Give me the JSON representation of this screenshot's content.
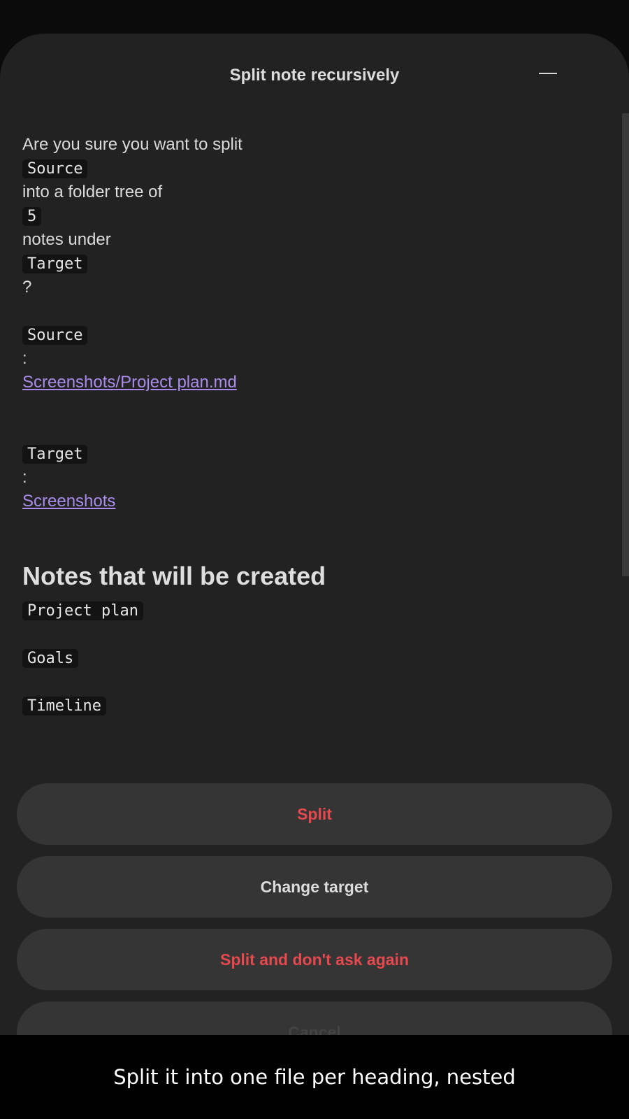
{
  "dialog": {
    "title": "Split note recursively",
    "collapse_icon": "minus-icon"
  },
  "message": {
    "intro": "Are you sure you want to split",
    "source_code": "Source",
    "into_text": "into a folder tree of",
    "count": "5",
    "notes_under_text": "notes under",
    "target_code": "Target",
    "question_mark": "?"
  },
  "source": {
    "label": "Source",
    "colon": ":",
    "link": "Screenshots/Project plan.md"
  },
  "target": {
    "label": "Target",
    "colon": ":",
    "link": "Screenshots"
  },
  "notes_section": {
    "heading": "Notes that will be created",
    "items": [
      "Project plan",
      "Goals",
      "Timeline"
    ]
  },
  "buttons": {
    "split": "Split",
    "change_target": "Change target",
    "split_no_ask": "Split and don't ask again",
    "cancel": "Cancel"
  },
  "caption": "Split it into one file per heading, nested",
  "colors": {
    "danger": "#e5484d",
    "link": "#a88beb",
    "sheet_background": "#222222"
  }
}
